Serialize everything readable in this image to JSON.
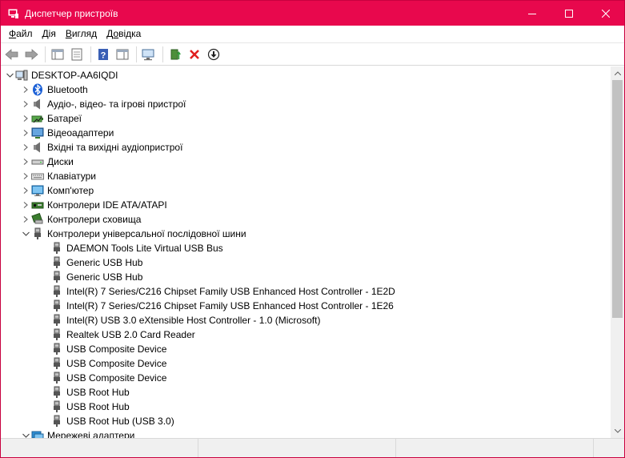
{
  "window": {
    "title": "Диспетчер пристроїв",
    "accent_color": "#e8084d"
  },
  "menu": {
    "items": [
      {
        "label": "Файл",
        "hotkey": "Ф",
        "rest": "айл"
      },
      {
        "label": "Дія",
        "hotkey": "Д",
        "rest": "ія"
      },
      {
        "label": "Вигляд",
        "hotkey": "В",
        "rest": "игляд"
      },
      {
        "label": "Довідка",
        "hotkey": "о",
        "prefix": "Д",
        "rest": "відка"
      }
    ]
  },
  "toolbar": {
    "buttons": [
      "back-arrow",
      "forward-arrow",
      "console-tree",
      "properties",
      "help",
      "action-pane",
      "scan-hardware",
      "update-driver",
      "uninstall-device",
      "disable-device"
    ]
  },
  "tree": {
    "root": "DESKTOP-AA6IQDI",
    "categories": [
      {
        "label": "Bluetooth",
        "icon": "bluetooth-icon",
        "expanded": false
      },
      {
        "label": "Аудіо-, відео- та ігрові пристрої",
        "icon": "speaker-icon",
        "expanded": false
      },
      {
        "label": "Батареї",
        "icon": "battery-icon",
        "expanded": false
      },
      {
        "label": "Відеоадаптери",
        "icon": "display-adapter-icon",
        "expanded": false
      },
      {
        "label": "Вхідні та вихідні аудіопристрої",
        "icon": "speaker-icon",
        "expanded": false
      },
      {
        "label": "Диски",
        "icon": "disk-drive-icon",
        "expanded": false
      },
      {
        "label": "Клавіатури",
        "icon": "keyboard-icon",
        "expanded": false
      },
      {
        "label": "Комп'ютер",
        "icon": "computer-monitor-icon",
        "expanded": false
      },
      {
        "label": "Контролери IDE ATA/ATAPI",
        "icon": "ide-controller-icon",
        "expanded": false
      },
      {
        "label": "Контролери сховища",
        "icon": "storage-controller-icon",
        "expanded": false
      },
      {
        "label": "Контролери універсальної послідовної шини",
        "icon": "usb-plug-icon",
        "expanded": true
      },
      {
        "label": "Мережеві адаптери",
        "icon": "network-adapter-icon",
        "expanded": true
      }
    ],
    "usb_devices": [
      "DAEMON Tools Lite Virtual USB Bus",
      "Generic USB Hub",
      "Generic USB Hub",
      "Intel(R) 7 Series/C216 Chipset Family USB Enhanced Host Controller - 1E2D",
      "Intel(R) 7 Series/C216 Chipset Family USB Enhanced Host Controller - 1E26",
      "Intel(R) USB 3.0 eXtensible Host Controller - 1.0 (Microsoft)",
      "Realtek USB 2.0 Card Reader",
      "USB Composite Device",
      "USB Composite Device",
      "USB Composite Device",
      "USB Root Hub",
      "USB Root Hub",
      "USB Root Hub (USB 3.0)"
    ]
  }
}
